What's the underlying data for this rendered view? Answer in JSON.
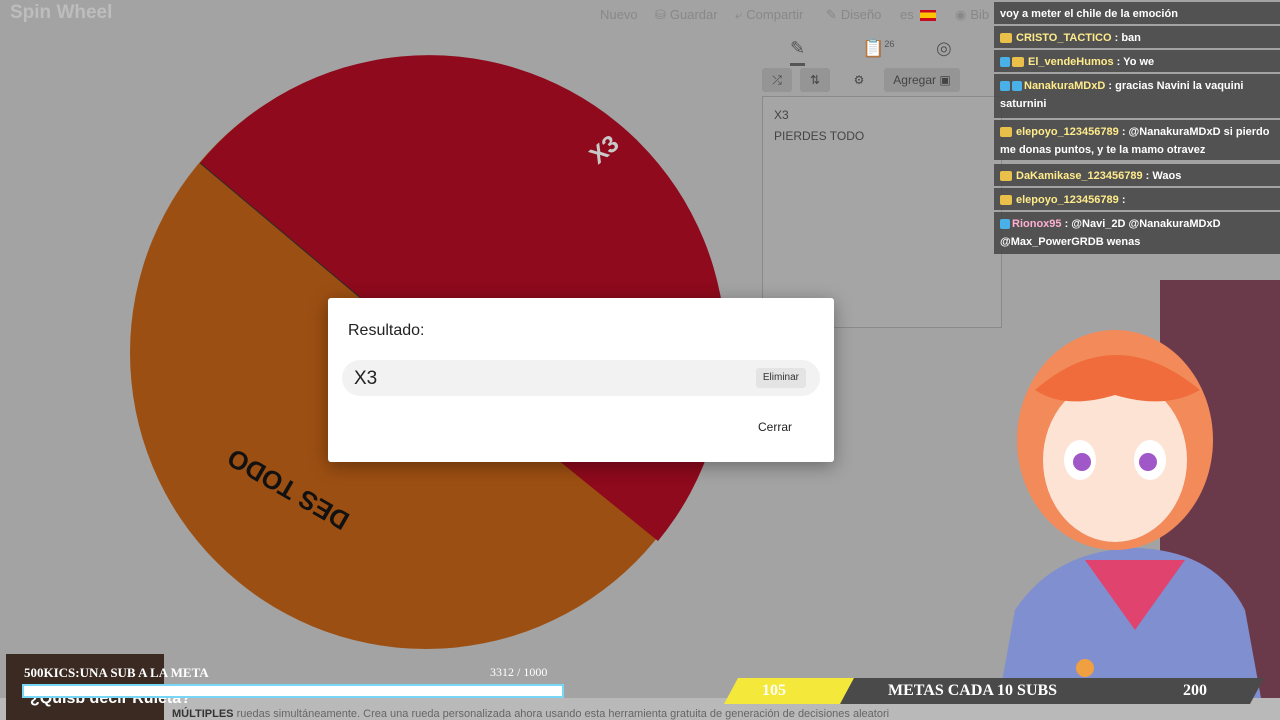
{
  "app": {
    "title": "Spin Wheel"
  },
  "nav": {
    "new_label": "Nuevo",
    "save_label": "Guardar",
    "share_label": "Compartir",
    "design_label": "Diseño",
    "lang": "es",
    "more_label": "Bib"
  },
  "wheel": {
    "segments": [
      {
        "label": "X3",
        "color": "#8e0a1c"
      },
      {
        "label": "PIERDES TODO",
        "color": "#9c4f12"
      }
    ],
    "visible_label_1": "X3",
    "visible_label_2": "DES TODO"
  },
  "panel": {
    "tab_edit": "✎",
    "tab_results_badge": "26",
    "tab_hide": "👁",
    "shuffle": "⤮",
    "sort": "⇅",
    "settings": "⚙",
    "add_label": "Agregar",
    "entries": [
      "X3",
      "PIERDES TODO"
    ]
  },
  "modal": {
    "title": "Resultado:",
    "result": "X3",
    "delete_label": "Eliminar",
    "close_label": "Cerrar"
  },
  "chat": [
    {
      "user": "",
      "text": "voy a meter el chile de la emoción"
    },
    {
      "user": "CRISTO_TACTICO",
      "text": ": ban"
    },
    {
      "user": "El_vendeHumos",
      "text": ": Yo we"
    },
    {
      "user": "NanakuraMDxD",
      "text": ": gracias Navini la vaquini saturnini"
    },
    {
      "user": "elepoyo_123456789",
      "text": ": @NanakuraMDxD si pierdo me donas puntos, y te la mamo otravez"
    },
    {
      "user": "DaKamikase_123456789",
      "text": ": Waos"
    },
    {
      "user": "elepoyo_123456789",
      "text": ":"
    },
    {
      "user": "Rionox95",
      "text": ": @Navi_2D @NanakuraMDxD @Max_PowerGRDB wenas"
    }
  ],
  "stream": {
    "sub_goal_label": "500KICS:UNA SUB A LA META",
    "sub_current": "3312",
    "sub_sep": "/",
    "sub_target": "1000",
    "goal_left": "105",
    "goal_label": "METAS CADA 10 SUBS",
    "goal_right": "200",
    "mini_text": "¿Quisb decir Ruleta?",
    "bottom_bold": "MÚLTIPLES",
    "bottom_text": "ruedas simultáneamente. Crea una rueda personalizada ahora usando esta herramienta gratuita de generación de decisiones aleatori"
  },
  "colors": {
    "wheel_red": "#8e0a1c",
    "wheel_orange": "#9c4f12",
    "goal_yellow": "#f4e93a",
    "accent_blue": "#78d7f6"
  }
}
